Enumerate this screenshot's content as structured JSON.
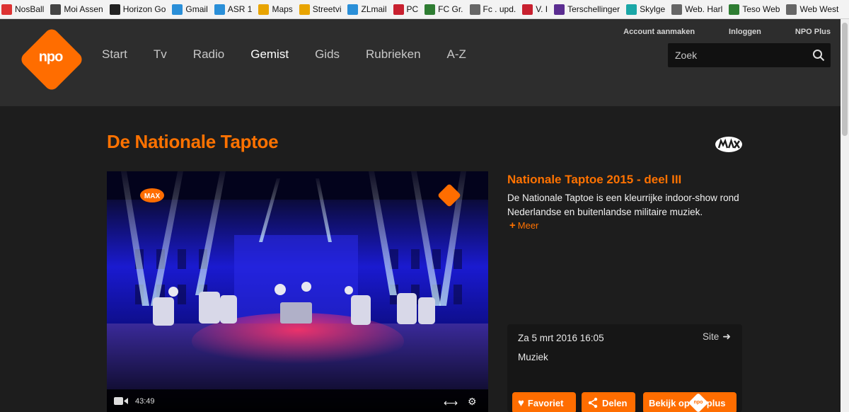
{
  "bookmarks": [
    {
      "label": "NosBall",
      "icon": "nos-icon",
      "color": "#d33"
    },
    {
      "label": "Moi Assen",
      "icon": "bird-icon",
      "color": "#444"
    },
    {
      "label": "Horizon Go",
      "icon": "horizon-icon",
      "color": "#222"
    },
    {
      "label": "Gmail",
      "icon": "globe-icon",
      "color": "#2a8fd8"
    },
    {
      "label": "ASR 1",
      "icon": "globe-icon",
      "color": "#2a8fd8"
    },
    {
      "label": "Maps",
      "icon": "maps-icon",
      "color": "#e8a400"
    },
    {
      "label": "Streetvi",
      "icon": "streetview-icon",
      "color": "#e8a400"
    },
    {
      "label": "ZLmail",
      "icon": "globe-icon",
      "color": "#2a8fd8"
    },
    {
      "label": "PC",
      "icon": "pc-icon",
      "color": "#c8202f"
    },
    {
      "label": "FC Gr.",
      "icon": "fc-icon",
      "color": "#2e7d32"
    },
    {
      "label": "Fc . upd.",
      "icon": "doc-icon",
      "color": "#666"
    },
    {
      "label": "V. I",
      "icon": "vi-icon",
      "color": "#c8202f"
    },
    {
      "label": "Terschellinger",
      "icon": "flag-icon",
      "color": "#5b2d91"
    },
    {
      "label": "Skylge",
      "icon": "s-icon",
      "color": "#1aa7a7"
    },
    {
      "label": "Web. Harl",
      "icon": "doc-icon",
      "color": "#666"
    },
    {
      "label": "Teso Web",
      "icon": "teso-icon",
      "color": "#2e7d32"
    },
    {
      "label": "Web West",
      "icon": "doc-icon",
      "color": "#666"
    }
  ],
  "header": {
    "logo_text": "npo",
    "nav": [
      {
        "label": "Start",
        "active": false
      },
      {
        "label": "Tv",
        "active": false
      },
      {
        "label": "Radio",
        "active": false
      },
      {
        "label": "Gemist",
        "active": true
      },
      {
        "label": "Gids",
        "active": false
      },
      {
        "label": "Rubrieken",
        "active": false
      },
      {
        "label": "A-Z",
        "active": false
      }
    ],
    "toplinks": [
      "Account aanmaken",
      "Inloggen",
      "NPO Plus"
    ],
    "search_placeholder": "Zoek"
  },
  "program": {
    "title": "De Nationale Taptoe",
    "broadcaster_logo": "max-logo-icon"
  },
  "video": {
    "duration": "43:49"
  },
  "episode": {
    "title": "Nationale Taptoe 2015 - deel III",
    "description": "De Nationale Taptoe is een kleurrijke indoor-show rond Nederlandse en buitenlandse militaire muziek.",
    "more_label": "Meer",
    "date": "Za 5 mrt 2016 16:05",
    "site_label": "Site",
    "genre": "Muziek"
  },
  "actions": {
    "favorite_label": "Favoriet",
    "share_label": "Delen",
    "watch_label_prefix": "Bekijk op",
    "watch_label_suffix": "plus"
  },
  "colors": {
    "accent": "#ff6d00",
    "header_bg": "#2d2d2d",
    "page_bg": "#1d1d1d"
  }
}
